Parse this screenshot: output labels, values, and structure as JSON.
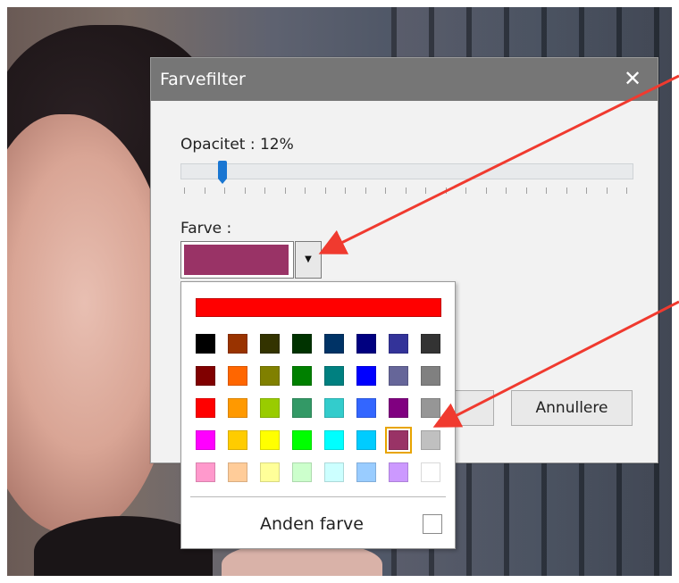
{
  "dialog": {
    "title": "Farvefilter",
    "close_glyph": "✕",
    "opacity_label": "Opacitet : 12%",
    "opacity_value": 0.12,
    "color_label": "Farve :",
    "selected_color": "#993366",
    "dropdown_glyph": "▼",
    "cancel_label": "Annullere"
  },
  "popup": {
    "top_color": "#ff0000",
    "rows": [
      [
        "#000000",
        "#993300",
        "#333300",
        "#003300",
        "#003366",
        "#000080",
        "#333399",
        "#333333"
      ],
      [
        "#800000",
        "#ff6600",
        "#808000",
        "#008000",
        "#008080",
        "#0000ff",
        "#666699",
        "#808080"
      ],
      [
        "#ff0000",
        "#ff9900",
        "#99cc00",
        "#339966",
        "#33cccc",
        "#3366ff",
        "#800080",
        "#969696"
      ],
      [
        "#ff00ff",
        "#ffcc00",
        "#ffff00",
        "#00ff00",
        "#00ffff",
        "#00ccff",
        "#993366",
        "#c0c0c0"
      ],
      [
        "#ff99cc",
        "#ffcc99",
        "#ffff99",
        "#ccffcc",
        "#ccffff",
        "#99ccff",
        "#cc99ff",
        "#ffffff"
      ]
    ],
    "selected_index": [
      3,
      6
    ],
    "other_color_label": "Anden farve"
  },
  "annotations": {
    "arrow_color": "#f03a2f"
  }
}
